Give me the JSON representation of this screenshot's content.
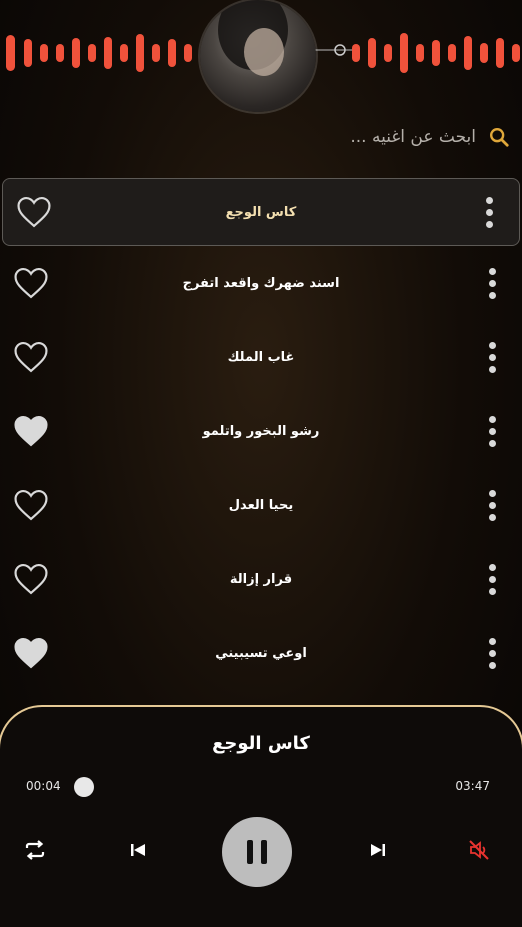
{
  "header": {
    "avatar_icon": "singer-photo"
  },
  "search": {
    "placeholder": "ابحث عن اغنيه ...",
    "icon": "search-icon",
    "icon_color": "#e0a83a"
  },
  "songs": [
    {
      "title": "كاس الوجع",
      "liked": false,
      "active": true
    },
    {
      "title": "اسند ضهرك واقعد اتفرج",
      "liked": false,
      "active": false
    },
    {
      "title": "غاب الملك",
      "liked": false,
      "active": false
    },
    {
      "title": "رشو البخور واتلمو",
      "liked": true,
      "active": false
    },
    {
      "title": "يحيا العدل",
      "liked": false,
      "active": false
    },
    {
      "title": "قرار إزالة",
      "liked": false,
      "active": false
    },
    {
      "title": "اوعي تسيبيني",
      "liked": true,
      "active": false
    }
  ],
  "player": {
    "title": "كاس الوجع",
    "current_time": "00:04",
    "total_time": "03:47",
    "progress": 0.018,
    "muted": true,
    "accent_color": "#e5c995",
    "wave_color": "#f0523b"
  }
}
